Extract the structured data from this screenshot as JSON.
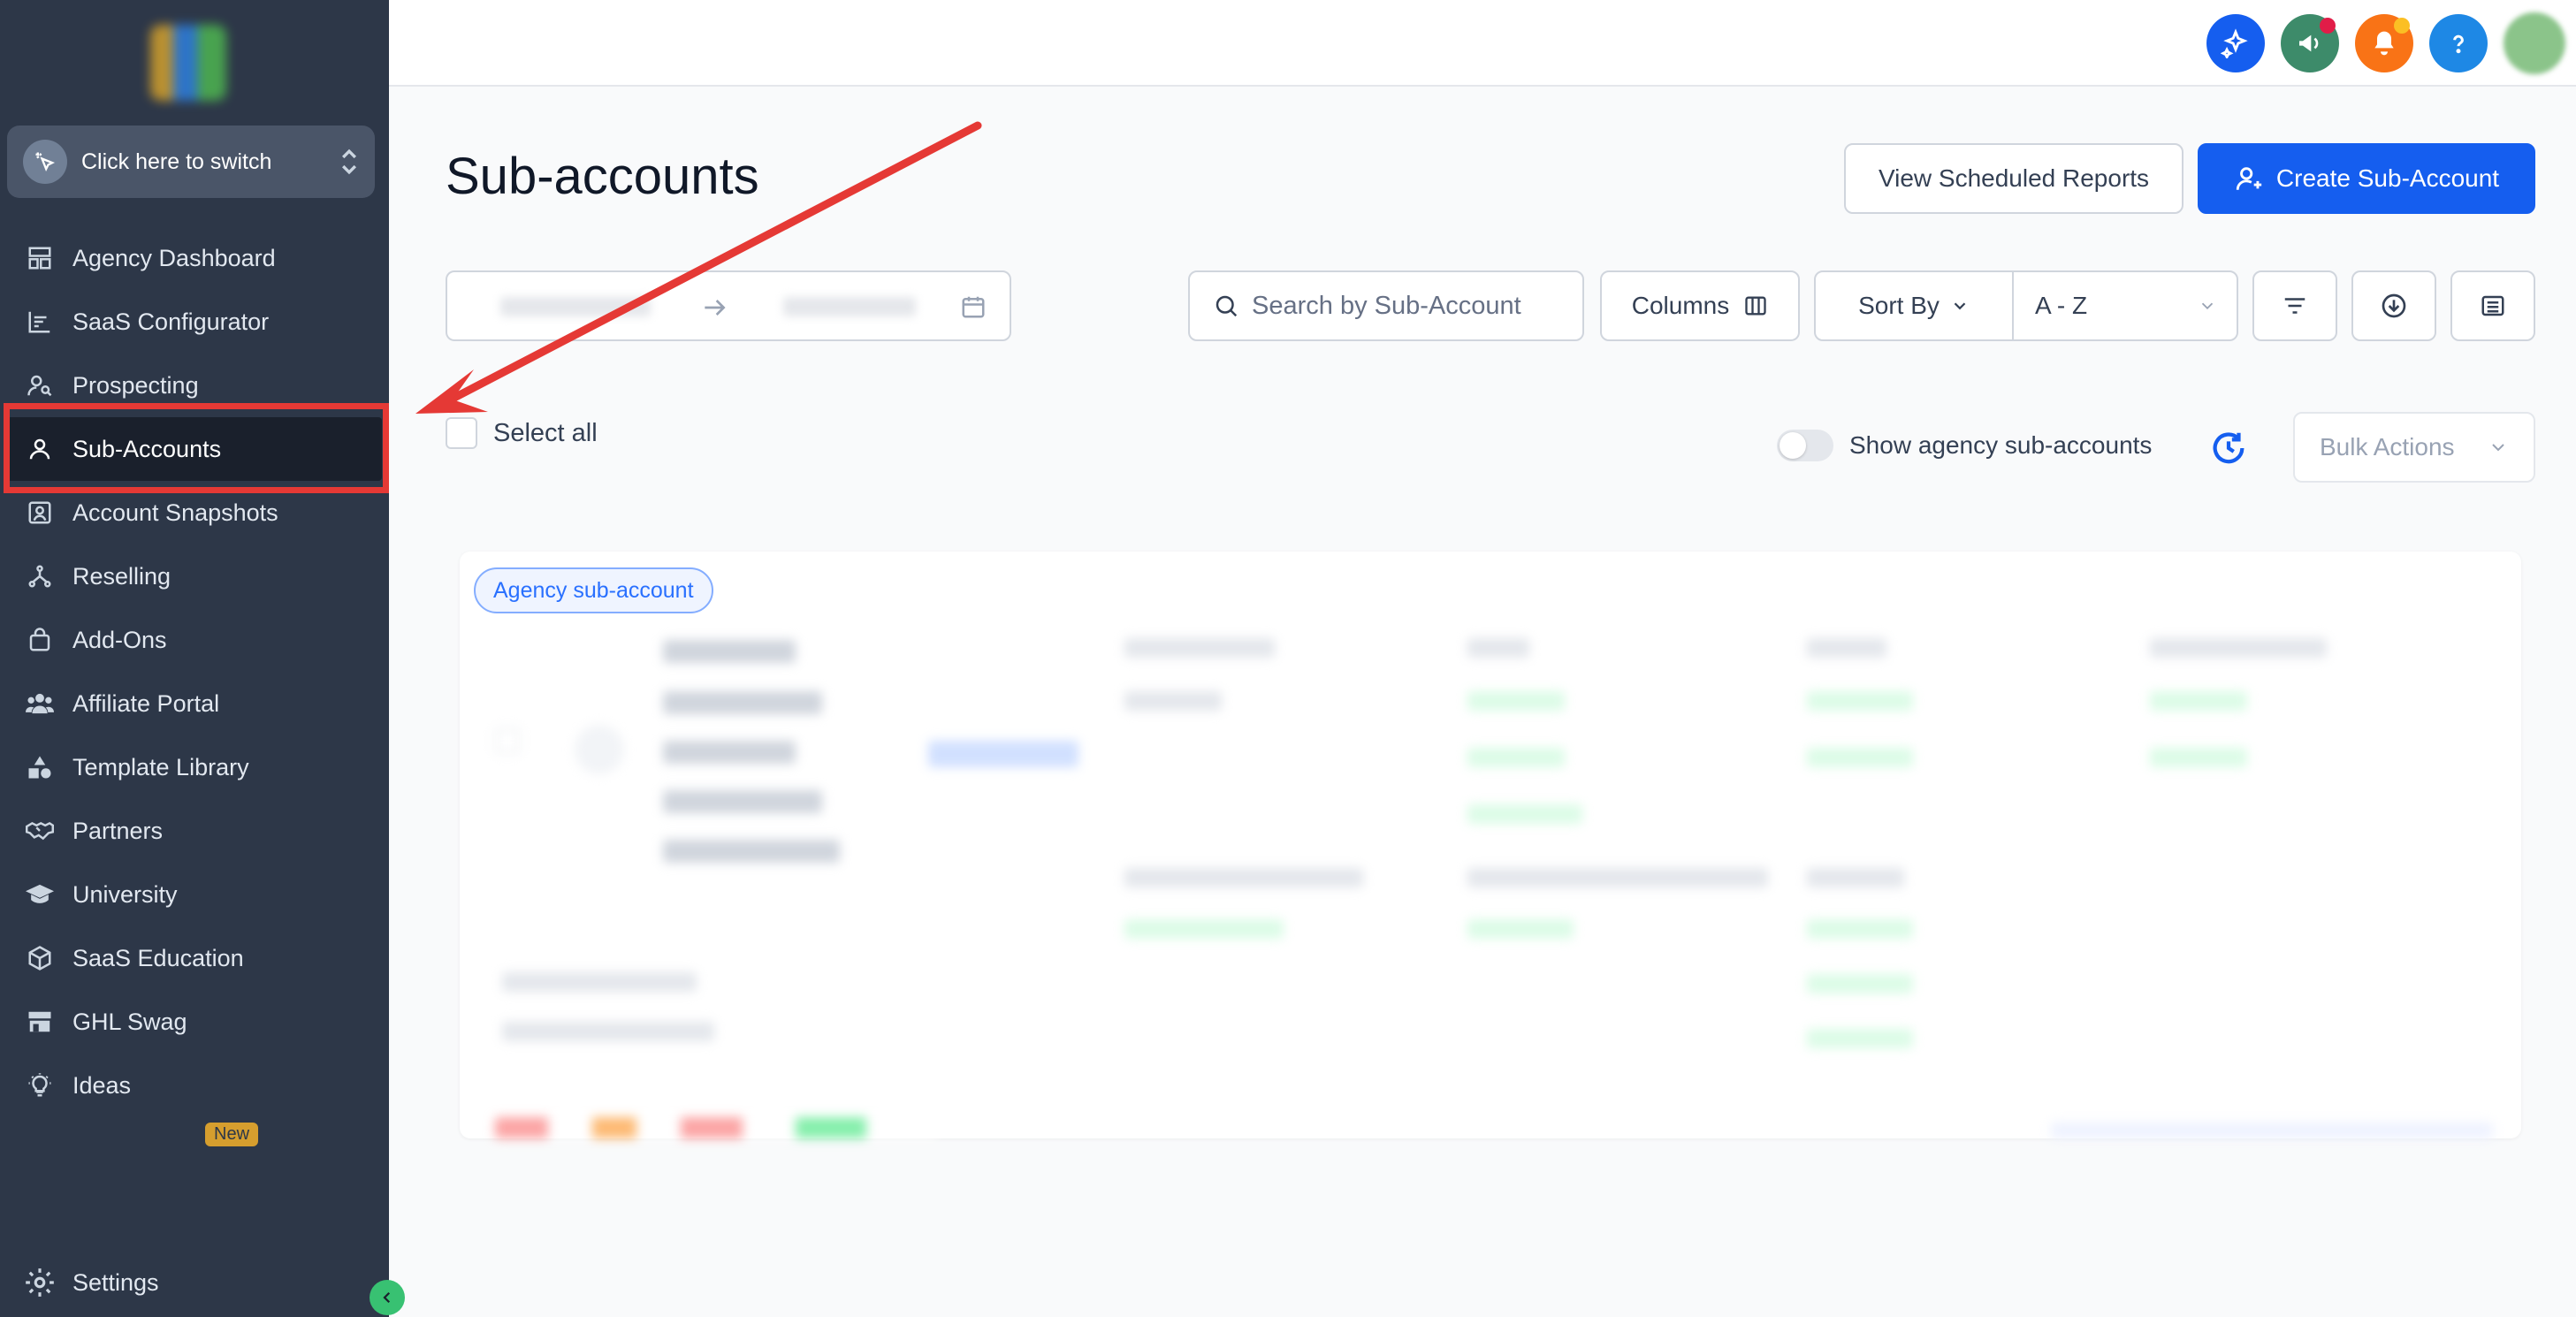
{
  "sidebar": {
    "switcher_label": "Click here to switch",
    "items": [
      {
        "label": "Agency Dashboard",
        "icon": "dashboard-icon"
      },
      {
        "label": "SaaS Configurator",
        "icon": "chart-icon"
      },
      {
        "label": "Prospecting",
        "icon": "prospecting-icon"
      },
      {
        "label": "Sub-Accounts",
        "icon": "user-icon",
        "active": true
      },
      {
        "label": "Account Snapshots",
        "icon": "snapshot-icon"
      },
      {
        "label": "Reselling",
        "icon": "reselling-icon"
      },
      {
        "label": "Add-Ons",
        "icon": "bag-icon"
      },
      {
        "label": "Affiliate Portal",
        "icon": "users-icon"
      },
      {
        "label": "Template Library",
        "icon": "shapes-icon"
      },
      {
        "label": "Partners",
        "icon": "handshake-icon"
      },
      {
        "label": "University",
        "icon": "graduation-icon"
      },
      {
        "label": "SaaS Education",
        "icon": "cube-icon"
      },
      {
        "label": "GHL Swag",
        "icon": "store-icon"
      },
      {
        "label": "Ideas",
        "icon": "lightbulb-icon"
      }
    ],
    "new_badge": "New",
    "settings_label": "Settings"
  },
  "topbar": {
    "icons": [
      "sparkle-icon",
      "megaphone-icon",
      "bell-icon",
      "help-icon"
    ],
    "colors": {
      "sparkle": "#155eef",
      "megaphone": "#3d8b6a",
      "bell": "#f97316",
      "help": "#1e88e5"
    }
  },
  "main": {
    "title": "Sub-accounts",
    "view_reports_label": "View Scheduled Reports",
    "create_label": "Create Sub-Account",
    "search_placeholder": "Search by Sub-Account",
    "columns_label": "Columns",
    "sort_by_label": "Sort By",
    "sort_value": "A - Z",
    "select_all_label": "Select all",
    "show_agency_label": "Show agency sub-accounts",
    "bulk_actions_label": "Bulk Actions",
    "card": {
      "badge": "Agency sub-account"
    }
  }
}
